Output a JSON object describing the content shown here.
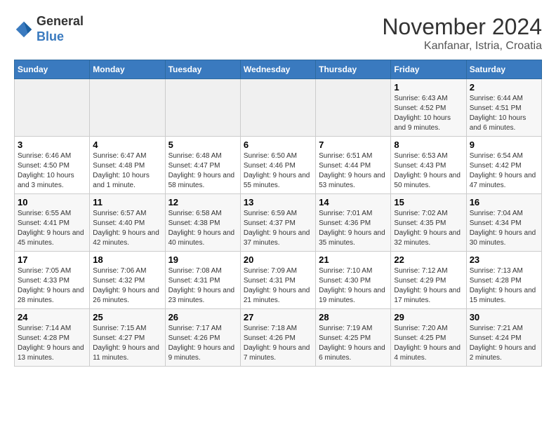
{
  "header": {
    "logo_general": "General",
    "logo_blue": "Blue",
    "month_title": "November 2024",
    "location": "Kanfanar, Istria, Croatia"
  },
  "weekdays": [
    "Sunday",
    "Monday",
    "Tuesday",
    "Wednesday",
    "Thursday",
    "Friday",
    "Saturday"
  ],
  "weeks": [
    [
      {
        "day": "",
        "info": ""
      },
      {
        "day": "",
        "info": ""
      },
      {
        "day": "",
        "info": ""
      },
      {
        "day": "",
        "info": ""
      },
      {
        "day": "",
        "info": ""
      },
      {
        "day": "1",
        "info": "Sunrise: 6:43 AM\nSunset: 4:52 PM\nDaylight: 10 hours and 9 minutes."
      },
      {
        "day": "2",
        "info": "Sunrise: 6:44 AM\nSunset: 4:51 PM\nDaylight: 10 hours and 6 minutes."
      }
    ],
    [
      {
        "day": "3",
        "info": "Sunrise: 6:46 AM\nSunset: 4:50 PM\nDaylight: 10 hours and 3 minutes."
      },
      {
        "day": "4",
        "info": "Sunrise: 6:47 AM\nSunset: 4:48 PM\nDaylight: 10 hours and 1 minute."
      },
      {
        "day": "5",
        "info": "Sunrise: 6:48 AM\nSunset: 4:47 PM\nDaylight: 9 hours and 58 minutes."
      },
      {
        "day": "6",
        "info": "Sunrise: 6:50 AM\nSunset: 4:46 PM\nDaylight: 9 hours and 55 minutes."
      },
      {
        "day": "7",
        "info": "Sunrise: 6:51 AM\nSunset: 4:44 PM\nDaylight: 9 hours and 53 minutes."
      },
      {
        "day": "8",
        "info": "Sunrise: 6:53 AM\nSunset: 4:43 PM\nDaylight: 9 hours and 50 minutes."
      },
      {
        "day": "9",
        "info": "Sunrise: 6:54 AM\nSunset: 4:42 PM\nDaylight: 9 hours and 47 minutes."
      }
    ],
    [
      {
        "day": "10",
        "info": "Sunrise: 6:55 AM\nSunset: 4:41 PM\nDaylight: 9 hours and 45 minutes."
      },
      {
        "day": "11",
        "info": "Sunrise: 6:57 AM\nSunset: 4:40 PM\nDaylight: 9 hours and 42 minutes."
      },
      {
        "day": "12",
        "info": "Sunrise: 6:58 AM\nSunset: 4:38 PM\nDaylight: 9 hours and 40 minutes."
      },
      {
        "day": "13",
        "info": "Sunrise: 6:59 AM\nSunset: 4:37 PM\nDaylight: 9 hours and 37 minutes."
      },
      {
        "day": "14",
        "info": "Sunrise: 7:01 AM\nSunset: 4:36 PM\nDaylight: 9 hours and 35 minutes."
      },
      {
        "day": "15",
        "info": "Sunrise: 7:02 AM\nSunset: 4:35 PM\nDaylight: 9 hours and 32 minutes."
      },
      {
        "day": "16",
        "info": "Sunrise: 7:04 AM\nSunset: 4:34 PM\nDaylight: 9 hours and 30 minutes."
      }
    ],
    [
      {
        "day": "17",
        "info": "Sunrise: 7:05 AM\nSunset: 4:33 PM\nDaylight: 9 hours and 28 minutes."
      },
      {
        "day": "18",
        "info": "Sunrise: 7:06 AM\nSunset: 4:32 PM\nDaylight: 9 hours and 26 minutes."
      },
      {
        "day": "19",
        "info": "Sunrise: 7:08 AM\nSunset: 4:31 PM\nDaylight: 9 hours and 23 minutes."
      },
      {
        "day": "20",
        "info": "Sunrise: 7:09 AM\nSunset: 4:31 PM\nDaylight: 9 hours and 21 minutes."
      },
      {
        "day": "21",
        "info": "Sunrise: 7:10 AM\nSunset: 4:30 PM\nDaylight: 9 hours and 19 minutes."
      },
      {
        "day": "22",
        "info": "Sunrise: 7:12 AM\nSunset: 4:29 PM\nDaylight: 9 hours and 17 minutes."
      },
      {
        "day": "23",
        "info": "Sunrise: 7:13 AM\nSunset: 4:28 PM\nDaylight: 9 hours and 15 minutes."
      }
    ],
    [
      {
        "day": "24",
        "info": "Sunrise: 7:14 AM\nSunset: 4:28 PM\nDaylight: 9 hours and 13 minutes."
      },
      {
        "day": "25",
        "info": "Sunrise: 7:15 AM\nSunset: 4:27 PM\nDaylight: 9 hours and 11 minutes."
      },
      {
        "day": "26",
        "info": "Sunrise: 7:17 AM\nSunset: 4:26 PM\nDaylight: 9 hours and 9 minutes."
      },
      {
        "day": "27",
        "info": "Sunrise: 7:18 AM\nSunset: 4:26 PM\nDaylight: 9 hours and 7 minutes."
      },
      {
        "day": "28",
        "info": "Sunrise: 7:19 AM\nSunset: 4:25 PM\nDaylight: 9 hours and 6 minutes."
      },
      {
        "day": "29",
        "info": "Sunrise: 7:20 AM\nSunset: 4:25 PM\nDaylight: 9 hours and 4 minutes."
      },
      {
        "day": "30",
        "info": "Sunrise: 7:21 AM\nSunset: 4:24 PM\nDaylight: 9 hours and 2 minutes."
      }
    ]
  ]
}
